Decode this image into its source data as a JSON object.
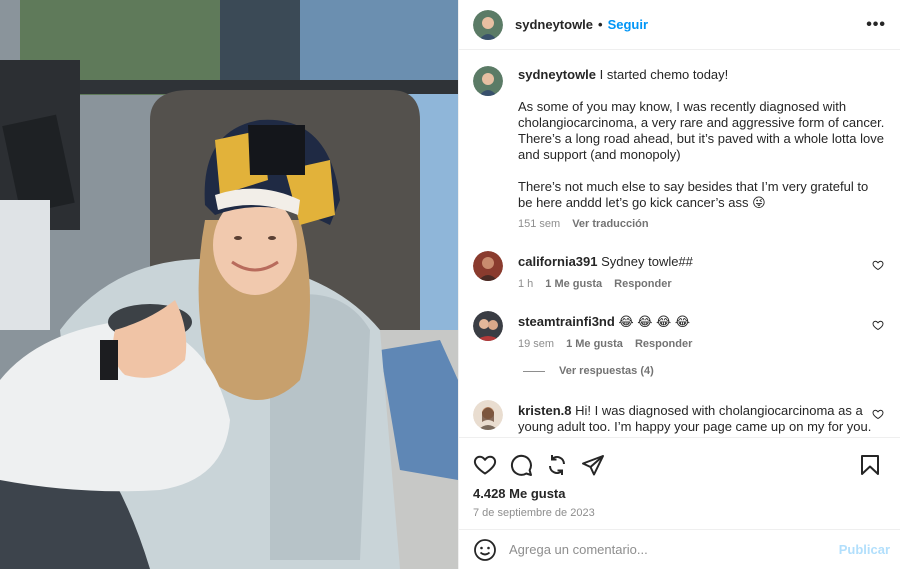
{
  "post": {
    "username": "sydneytowle",
    "separator": "•",
    "follow_label": "Seguir",
    "more_label": "•••",
    "caption": {
      "username": "sydneytowle",
      "line1": "I started chemo today!",
      "para2": "As some of you may know, I was recently diagnosed with cholangiocarcinoma, a very rare and aggressive form of cancer. There’s a long road ahead, but it’s paved with a whole lotta love and support (and monopoly)",
      "para3": "There’s not much else to say besides that I’m very grateful to be here anddd let’s go kick cancer’s ass 😜",
      "time": "151 sem",
      "translate_label": "Ver traducción"
    }
  },
  "comments": [
    {
      "username": "california391",
      "text": "Sydney towle##",
      "time": "1 h",
      "likes_label": "1 Me gusta",
      "reply_label": "Responder"
    },
    {
      "username": "steamtrainfi3nd",
      "text": "😂 😂 😂 😂",
      "time": "19 sem",
      "likes_label": "1 Me gusta",
      "reply_label": "Responder",
      "view_replies_label": "Ver respuestas (4)"
    },
    {
      "username": "kristen.8",
      "text": "Hi! I was diagnosed with cholangiocarcinoma as a young adult too. I’m happy your page came up on my for you."
    }
  ],
  "actions": {
    "icons": [
      "heart-icon",
      "comment-icon",
      "share-icon",
      "send-icon",
      "bookmark-icon"
    ],
    "likes_count": "4.428 Me gusta",
    "date": "7 de septiembre de 2023"
  },
  "comment_box": {
    "placeholder": "Agrega un comentario...",
    "publish_label": "Publicar"
  },
  "colors": {
    "accent": "#0095f6",
    "publish_disabled": "#b2dffc",
    "muted_text": "#8e8e8e"
  }
}
